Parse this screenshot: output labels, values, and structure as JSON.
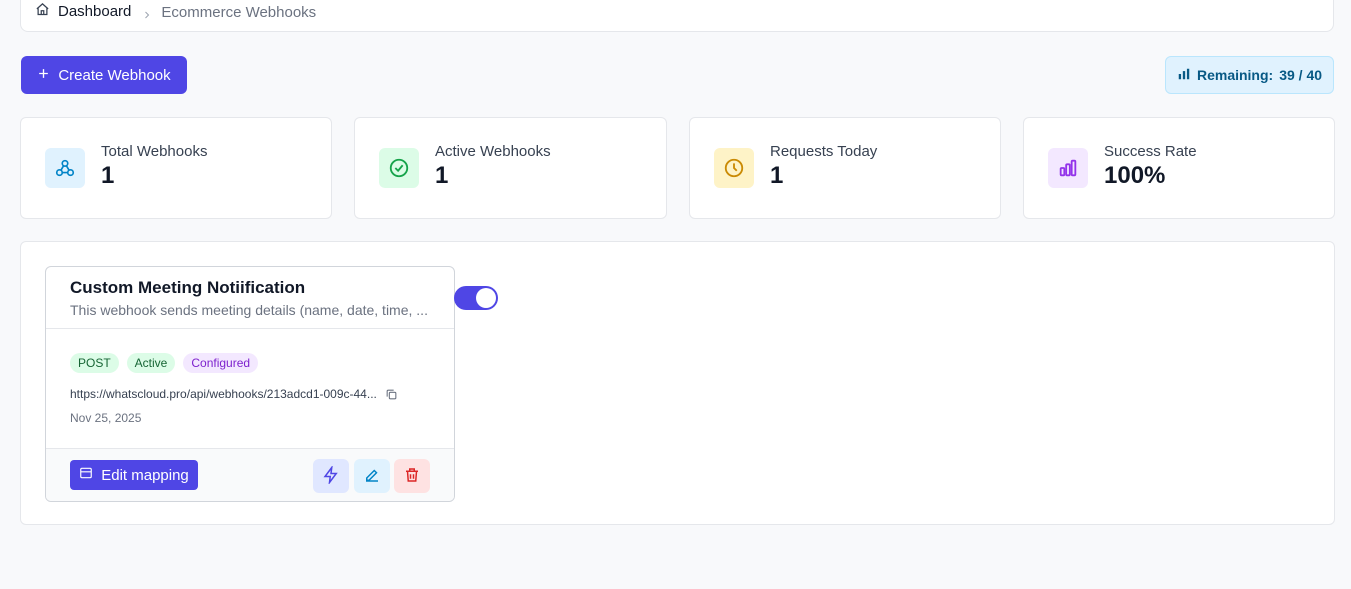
{
  "breadcrumb": {
    "home_label": "Dashboard",
    "current_label": "Ecommerce Webhooks"
  },
  "toolbar": {
    "create_label": "Create Webhook",
    "remaining_label": "Remaining:",
    "remaining_value": "39 / 40"
  },
  "stats": [
    {
      "label": "Total Webhooks",
      "value": "1",
      "icon": "webhook-icon",
      "color": "#0284c7",
      "bg": "#e0f2fe"
    },
    {
      "label": "Active Webhooks",
      "value": "1",
      "icon": "check-circle-icon",
      "color": "#16a34a",
      "bg": "#dcfce7"
    },
    {
      "label": "Requests Today",
      "value": "1",
      "icon": "clock-icon",
      "color": "#ca8a04",
      "bg": "#fef3c7"
    },
    {
      "label": "Success Rate",
      "value": "100%",
      "icon": "bar-chart-icon",
      "color": "#9333ea",
      "bg": "#f3e8ff"
    }
  ],
  "webhook": {
    "title": "Custom Meeting Notiification",
    "description": "This webhook sends meeting details (name, date, time, ...",
    "method": "POST",
    "status": "Active",
    "config": "Configured",
    "url": "https://whatscloud.pro/api/webhooks/213adcd1-009c-44...",
    "date": "Nov 25, 2025",
    "edit_label": "Edit mapping",
    "enabled": true
  },
  "colors": {
    "primary": "#4f46e5",
    "background": "#f8f9fb"
  }
}
